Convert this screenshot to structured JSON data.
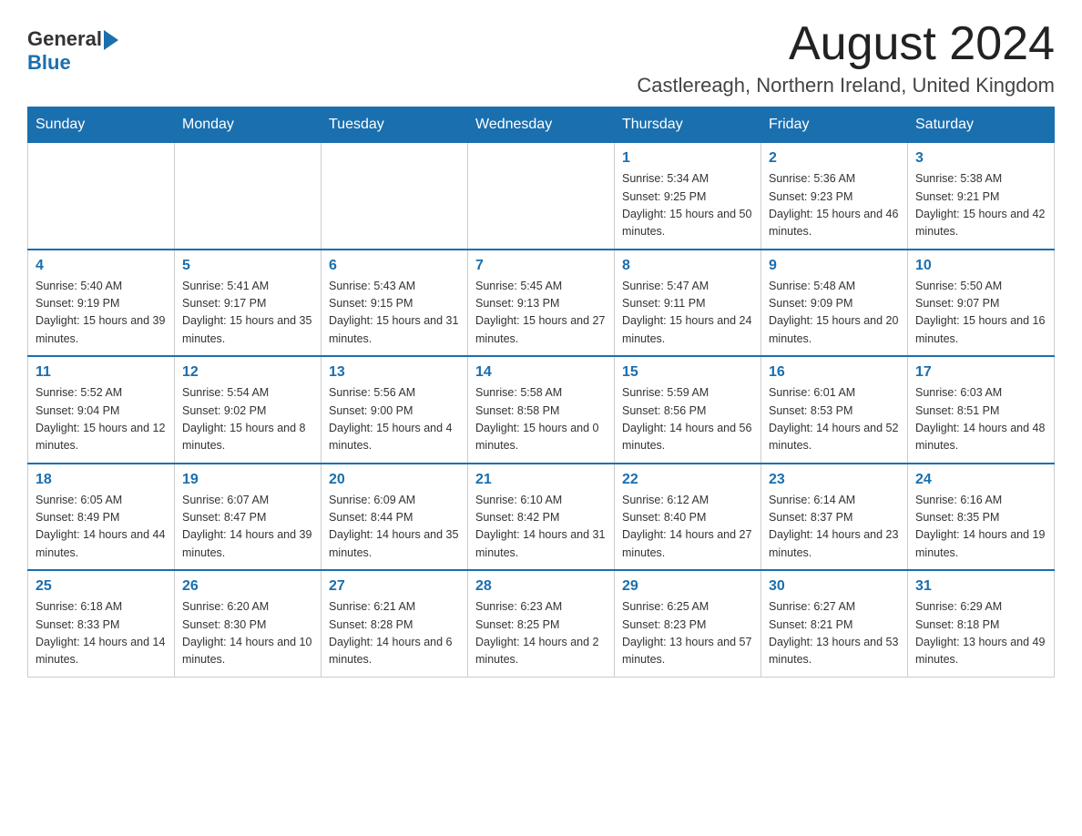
{
  "header": {
    "logo_general": "General",
    "logo_blue": "Blue",
    "month_title": "August 2024",
    "location": "Castlereagh, Northern Ireland, United Kingdom"
  },
  "days_of_week": [
    "Sunday",
    "Monday",
    "Tuesday",
    "Wednesday",
    "Thursday",
    "Friday",
    "Saturday"
  ],
  "weeks": [
    [
      {
        "day": "",
        "info": ""
      },
      {
        "day": "",
        "info": ""
      },
      {
        "day": "",
        "info": ""
      },
      {
        "day": "",
        "info": ""
      },
      {
        "day": "1",
        "info": "Sunrise: 5:34 AM\nSunset: 9:25 PM\nDaylight: 15 hours and 50 minutes."
      },
      {
        "day": "2",
        "info": "Sunrise: 5:36 AM\nSunset: 9:23 PM\nDaylight: 15 hours and 46 minutes."
      },
      {
        "day": "3",
        "info": "Sunrise: 5:38 AM\nSunset: 9:21 PM\nDaylight: 15 hours and 42 minutes."
      }
    ],
    [
      {
        "day": "4",
        "info": "Sunrise: 5:40 AM\nSunset: 9:19 PM\nDaylight: 15 hours and 39 minutes."
      },
      {
        "day": "5",
        "info": "Sunrise: 5:41 AM\nSunset: 9:17 PM\nDaylight: 15 hours and 35 minutes."
      },
      {
        "day": "6",
        "info": "Sunrise: 5:43 AM\nSunset: 9:15 PM\nDaylight: 15 hours and 31 minutes."
      },
      {
        "day": "7",
        "info": "Sunrise: 5:45 AM\nSunset: 9:13 PM\nDaylight: 15 hours and 27 minutes."
      },
      {
        "day": "8",
        "info": "Sunrise: 5:47 AM\nSunset: 9:11 PM\nDaylight: 15 hours and 24 minutes."
      },
      {
        "day": "9",
        "info": "Sunrise: 5:48 AM\nSunset: 9:09 PM\nDaylight: 15 hours and 20 minutes."
      },
      {
        "day": "10",
        "info": "Sunrise: 5:50 AM\nSunset: 9:07 PM\nDaylight: 15 hours and 16 minutes."
      }
    ],
    [
      {
        "day": "11",
        "info": "Sunrise: 5:52 AM\nSunset: 9:04 PM\nDaylight: 15 hours and 12 minutes."
      },
      {
        "day": "12",
        "info": "Sunrise: 5:54 AM\nSunset: 9:02 PM\nDaylight: 15 hours and 8 minutes."
      },
      {
        "day": "13",
        "info": "Sunrise: 5:56 AM\nSunset: 9:00 PM\nDaylight: 15 hours and 4 minutes."
      },
      {
        "day": "14",
        "info": "Sunrise: 5:58 AM\nSunset: 8:58 PM\nDaylight: 15 hours and 0 minutes."
      },
      {
        "day": "15",
        "info": "Sunrise: 5:59 AM\nSunset: 8:56 PM\nDaylight: 14 hours and 56 minutes."
      },
      {
        "day": "16",
        "info": "Sunrise: 6:01 AM\nSunset: 8:53 PM\nDaylight: 14 hours and 52 minutes."
      },
      {
        "day": "17",
        "info": "Sunrise: 6:03 AM\nSunset: 8:51 PM\nDaylight: 14 hours and 48 minutes."
      }
    ],
    [
      {
        "day": "18",
        "info": "Sunrise: 6:05 AM\nSunset: 8:49 PM\nDaylight: 14 hours and 44 minutes."
      },
      {
        "day": "19",
        "info": "Sunrise: 6:07 AM\nSunset: 8:47 PM\nDaylight: 14 hours and 39 minutes."
      },
      {
        "day": "20",
        "info": "Sunrise: 6:09 AM\nSunset: 8:44 PM\nDaylight: 14 hours and 35 minutes."
      },
      {
        "day": "21",
        "info": "Sunrise: 6:10 AM\nSunset: 8:42 PM\nDaylight: 14 hours and 31 minutes."
      },
      {
        "day": "22",
        "info": "Sunrise: 6:12 AM\nSunset: 8:40 PM\nDaylight: 14 hours and 27 minutes."
      },
      {
        "day": "23",
        "info": "Sunrise: 6:14 AM\nSunset: 8:37 PM\nDaylight: 14 hours and 23 minutes."
      },
      {
        "day": "24",
        "info": "Sunrise: 6:16 AM\nSunset: 8:35 PM\nDaylight: 14 hours and 19 minutes."
      }
    ],
    [
      {
        "day": "25",
        "info": "Sunrise: 6:18 AM\nSunset: 8:33 PM\nDaylight: 14 hours and 14 minutes."
      },
      {
        "day": "26",
        "info": "Sunrise: 6:20 AM\nSunset: 8:30 PM\nDaylight: 14 hours and 10 minutes."
      },
      {
        "day": "27",
        "info": "Sunrise: 6:21 AM\nSunset: 8:28 PM\nDaylight: 14 hours and 6 minutes."
      },
      {
        "day": "28",
        "info": "Sunrise: 6:23 AM\nSunset: 8:25 PM\nDaylight: 14 hours and 2 minutes."
      },
      {
        "day": "29",
        "info": "Sunrise: 6:25 AM\nSunset: 8:23 PM\nDaylight: 13 hours and 57 minutes."
      },
      {
        "day": "30",
        "info": "Sunrise: 6:27 AM\nSunset: 8:21 PM\nDaylight: 13 hours and 53 minutes."
      },
      {
        "day": "31",
        "info": "Sunrise: 6:29 AM\nSunset: 8:18 PM\nDaylight: 13 hours and 49 minutes."
      }
    ]
  ]
}
